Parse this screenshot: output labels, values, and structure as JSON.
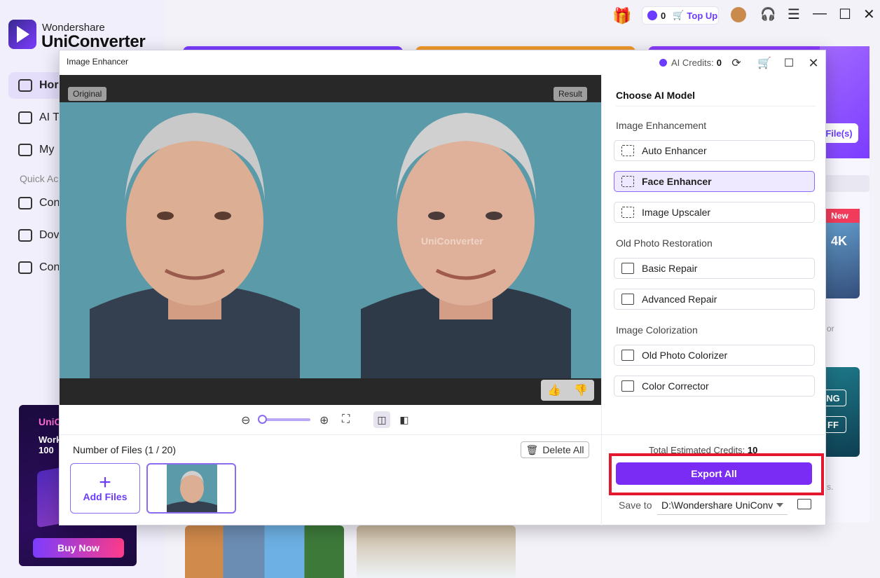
{
  "app": {
    "brand_top": "Wondershare",
    "brand_bottom": "UniConverter",
    "nav": [
      {
        "label": "Hor",
        "active": true
      },
      {
        "label": "AI To"
      },
      {
        "label": "My"
      }
    ],
    "quick_access_label": "Quick Ac",
    "quick_items": [
      "Con",
      "Dov",
      "Con"
    ],
    "promo": {
      "title": "UniC",
      "sub": "Work 100",
      "buy_label": "Buy Now"
    },
    "topbar": {
      "credits": "0",
      "top_up": "Top Up"
    },
    "right_peek": {
      "add_file": "File(s)",
      "badge_new": "New",
      "badge_4k": "4K",
      "label_or": "or",
      "label_ng": "NG",
      "label_ff": "FF",
      "label_s": "s."
    }
  },
  "dialog": {
    "title": "Image Enhancer",
    "ai_credits_label": "AI Credits:",
    "ai_credits_value": "0",
    "preview": {
      "original_tag": "Original",
      "result_tag": "Result",
      "watermark": "UniConverter"
    },
    "files": {
      "count_label": "Number of Files (1 / 20)",
      "delete_all": "Delete All",
      "add_files": "Add Files"
    },
    "panel": {
      "title": "Choose AI Model",
      "sections": [
        {
          "label": "Image Enhancement",
          "items": [
            "Auto Enhancer",
            "Face Enhancer",
            "Image Upscaler"
          ]
        },
        {
          "label": "Old Photo Restoration",
          "items": [
            "Basic Repair",
            "Advanced Repair"
          ]
        },
        {
          "label": "Image Colorization",
          "items": [
            "Old Photo Colorizer",
            "Color Corrector"
          ]
        }
      ],
      "selected_model": "Face Enhancer",
      "estimated_label": "Total Estimated Credits:",
      "estimated_value": "10",
      "export_all": "Export All",
      "save_to_label": "Save to",
      "save_path": "D:\\Wondershare UniConv"
    }
  },
  "colors": {
    "accent": "#7a2cf5",
    "highlight": "#e3172d"
  }
}
